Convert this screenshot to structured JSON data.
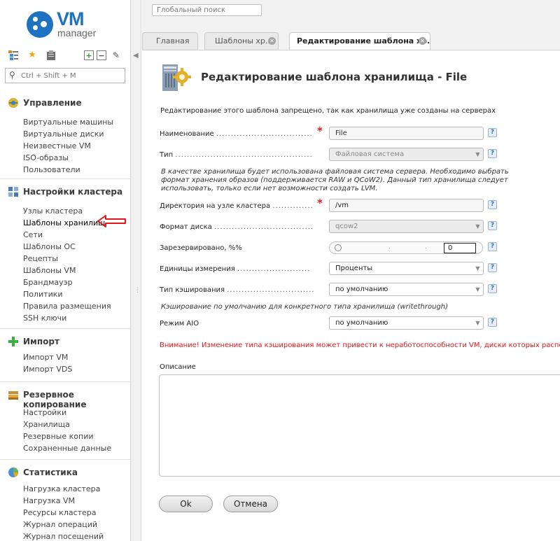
{
  "logo": {
    "vm": "VM",
    "manager": "manager"
  },
  "sidebar": {
    "search_placeholder": "Ctrl + Shift + M",
    "sections": [
      {
        "title": "Управление",
        "items": [
          "Виртуальные машины",
          "Виртуальные диски",
          "Неизвестные VM",
          "ISO-образы",
          "Пользователи"
        ]
      },
      {
        "title": "Настройки кластера",
        "items": [
          "Узлы кластера",
          "Шаблоны хранилищ",
          "Сети",
          "Шаблоны ОС",
          "Рецепты",
          "Шаблоны VM",
          "Брандмауэр",
          "Политики",
          "Правила размещения",
          "SSH ключи"
        ]
      },
      {
        "title": "Импорт",
        "items": [
          "Импорт VM",
          "Импорт VDS"
        ]
      },
      {
        "title": "Резервное копирование",
        "items": [
          "Настройки",
          "Хранилища",
          "Резервные копии",
          "Сохраненные данные"
        ]
      },
      {
        "title": "Статистика",
        "items": [
          "Нагрузка кластера",
          "Нагрузка VM",
          "Ресурсы кластера",
          "Журнал операций",
          "Журнал посещений"
        ]
      }
    ]
  },
  "topbar": {
    "search_placeholder": "Глобальный поиск"
  },
  "tabs": [
    {
      "label": "Главная"
    },
    {
      "label": "Шаблоны хр..."
    },
    {
      "label": "Редактирование шаблона хр..."
    }
  ],
  "form": {
    "title": "Редактирование шаблона хранилища - File",
    "notice": "Редактирование этого шаблона запрещено, так как хранилища уже созданы на серверах",
    "name_label": "Наименование",
    "name_value": "File",
    "type_label": "Тип",
    "type_value": "Файловая система",
    "type_hint_1": "В качестве хранилища будет использована файловая система сервера. Необходимо выбрать",
    "type_hint_2": "формат хранения образов (поддерживается RAW и QCoW2). Данный тип хранилища следует",
    "type_hint_3": "использовать, только если нет возможности создать LVM.",
    "dir_label": "Директория на узле кластера",
    "dir_value": "/vm",
    "format_label": "Формат диска",
    "format_value": "qcow2",
    "reserved_label": "Зарезервировано, %%",
    "reserved_value": "0",
    "units_label": "Единицы измерения",
    "units_value": "Проценты",
    "cache_label": "Тип кэширования",
    "cache_value": "по умолчанию",
    "cache_hint": "Кэширование по умолчанию для конкретного типа хранилища (writethrough)",
    "aio_label": "Режим AIO",
    "aio_value": "по умолчанию",
    "warning": "Внимание! Изменение типа кэширования может привести к неработоспособности VM, диски которых расположе",
    "desc_label": "Описание",
    "help": "?",
    "required_mark": "*",
    "ok": "Ok",
    "cancel": "Отмена"
  },
  "colors": {
    "accent": "#1d72c1",
    "warning": "#e0181b",
    "required": "#e02020"
  }
}
